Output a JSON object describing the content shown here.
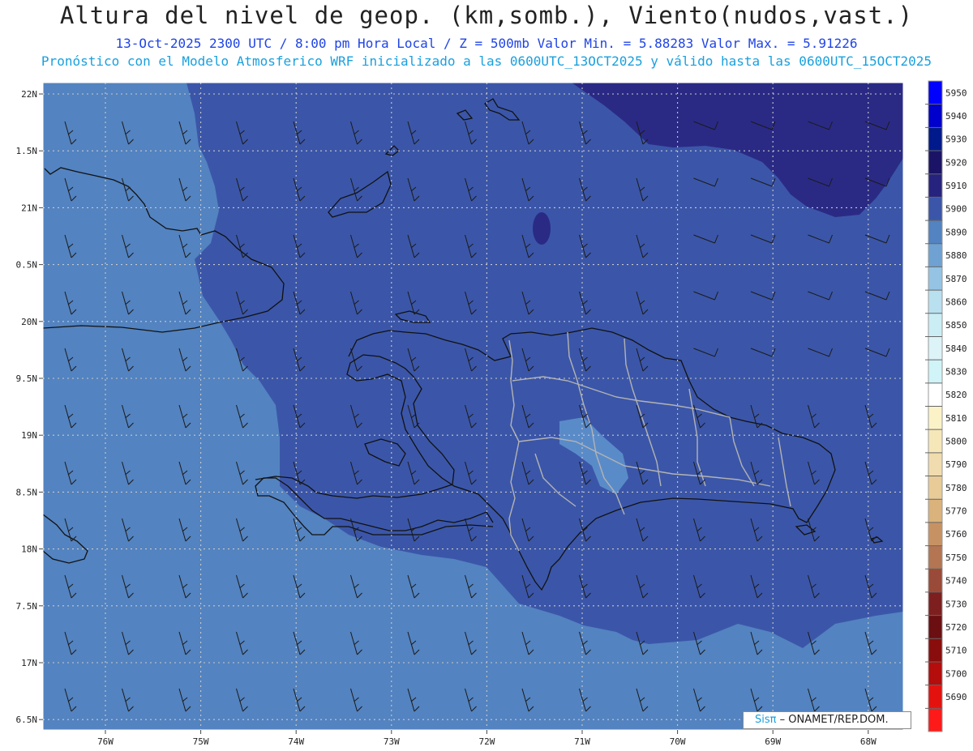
{
  "header": {
    "title": "Altura del nivel de geop. (km,somb.), Viento(nudos,vast.)",
    "info_line": "13-Oct-2025  2300 UTC / 8:00 pm Hora Local / Z = 500mb     Valor Min. = 5.88283  Valor Max. = 5.91226",
    "forecast_line": "Pronóstico con el Modelo Atmosferico WRF inicializado a las 0600UTC_13OCT2025 y válido hasta las  0600UTC_15OCT2025"
  },
  "map": {
    "lat_labels": [
      "22N",
      "1.5N",
      "21N",
      "0.5N",
      "20N",
      "9.5N",
      "19N",
      "8.5N",
      "18N",
      "7.5N",
      "17N",
      "6.5N"
    ],
    "lon_labels": [
      "76W",
      "75W",
      "74W",
      "73W",
      "72W",
      "71W",
      "70W",
      "69W",
      "68W"
    ],
    "field_colors": {
      "light": "#5383c0",
      "mid": "#3b56a8",
      "dark": "#2a2a85",
      "lake": "#5a8bc9"
    }
  },
  "colorbar": {
    "levels": [
      "5950",
      "5940",
      "5930",
      "5920",
      "5910",
      "5900",
      "5890",
      "5880",
      "5870",
      "5860",
      "5850",
      "5840",
      "5830",
      "5820",
      "5810",
      "5800",
      "5790",
      "5780",
      "5770",
      "5760",
      "5750",
      "5740",
      "5730",
      "5720",
      "5710",
      "5700",
      "5690"
    ],
    "colors": [
      "#0000ff",
      "#0000cc",
      "#001a8c",
      "#1b1466",
      "#26237f",
      "#3b56a8",
      "#5383c0",
      "#6fa2d2",
      "#95c3e3",
      "#b9e0ef",
      "#cbeef5",
      "#dcf3f7",
      "#d0f4f8",
      "#ffffff",
      "#fbf2c8",
      "#f6e7b9",
      "#f0dcae",
      "#e8cb97",
      "#d9b27c",
      "#c79263",
      "#b47553",
      "#9a4a38",
      "#7e1f1f",
      "#6b0f12",
      "#8a0d0d",
      "#b50c0c",
      "#e4120f",
      "#ff1a1a"
    ]
  },
  "credit": {
    "sis": "Sisπ",
    "text": "– ONAMET/REP.DOM."
  }
}
